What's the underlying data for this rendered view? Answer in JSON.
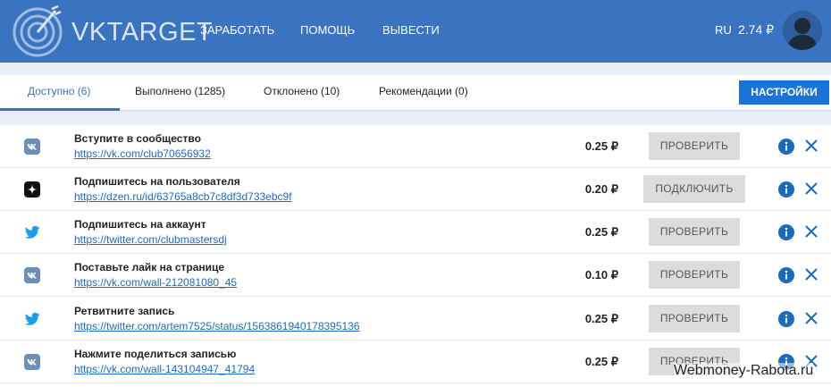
{
  "header": {
    "brand": "VKTARGET",
    "nav": [
      "ЗАРАБОТАТЬ",
      "ПОМОЩЬ",
      "ВЫВЕСТИ"
    ],
    "lang": "RU",
    "balance": "2.74 ₽"
  },
  "tabs": [
    {
      "label": "Доступно (6)",
      "active": true
    },
    {
      "label": "Выполнено (1285)",
      "active": false
    },
    {
      "label": "Отклонено (10)",
      "active": false
    },
    {
      "label": "Рекомендации (0)",
      "active": false
    }
  ],
  "settings_label": "НАСТРОЙКИ",
  "tasks": [
    {
      "service": "vk-icon",
      "title": "Вступите в сообщество",
      "link": "https://vk.com/club70656932",
      "price": "0.25 ₽",
      "action": "ПРОВЕРИТЬ"
    },
    {
      "service": "dzen-icon",
      "title": "Подпишитесь на пользователя",
      "link": "https://dzen.ru/id/63765a8cb7c8df3d733ebc9f",
      "price": "0.20 ₽",
      "action": "ПОДКЛЮЧИТЬ"
    },
    {
      "service": "twitter-icon",
      "title": "Подпишитесь на аккаунт",
      "link": "https://twitter.com/clubmastersdj",
      "price": "0.25 ₽",
      "action": "ПРОВЕРИТЬ"
    },
    {
      "service": "vk-icon",
      "title": "Поставьте лайк на странице",
      "link": "https://vk.com/wall-212081080_45",
      "price": "0.10 ₽",
      "action": "ПРОВЕРИТЬ"
    },
    {
      "service": "twitter-icon",
      "title": "Ретвитните запись",
      "link": "https://twitter.com/artem7525/status/1563861940178395136",
      "price": "0.25 ₽",
      "action": "ПРОВЕРИТЬ"
    },
    {
      "service": "vk-icon",
      "title": "Нажмите поделиться записью",
      "link": "https://vk.com/wall-143104947_41794",
      "price": "0.25 ₽",
      "action": "ПРОВЕРИТЬ"
    }
  ],
  "watermark": "Webmoney-Rabota.ru",
  "colors": {
    "header": "#3a74c0",
    "primary_button": "#1a73d9",
    "link": "#1a6ac2",
    "action_button": "#dcdcdc"
  }
}
